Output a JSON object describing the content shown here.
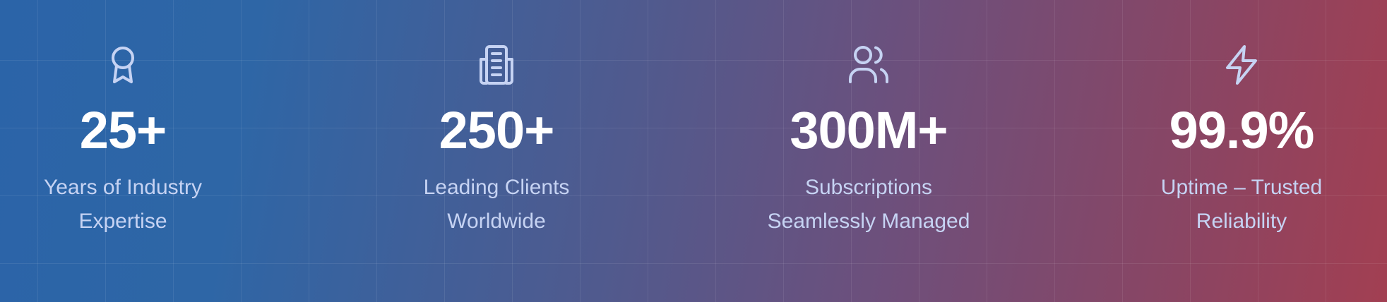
{
  "stats": [
    {
      "icon": "award-ribbon-icon",
      "value": "25+",
      "label_line1": "Years of Industry",
      "label_line2": "Expertise"
    },
    {
      "icon": "building-icon",
      "value": "250+",
      "label_line1": "Leading Clients",
      "label_line2": "Worldwide"
    },
    {
      "icon": "users-icon",
      "value": "300M+",
      "label_line1": "Subscriptions",
      "label_line2": "Seamlessly Managed"
    },
    {
      "icon": "lightning-bolt-icon",
      "value": "99.9%",
      "label_line1": "Uptime – Trusted",
      "label_line2": "Reliability"
    }
  ],
  "colors": {
    "gradient_start": "#2b64a8",
    "gradient_end": "#a23f52",
    "value_text": "#ffffff",
    "label_text": "#c6d3f3",
    "icon_stroke": "#c6d3f3"
  }
}
